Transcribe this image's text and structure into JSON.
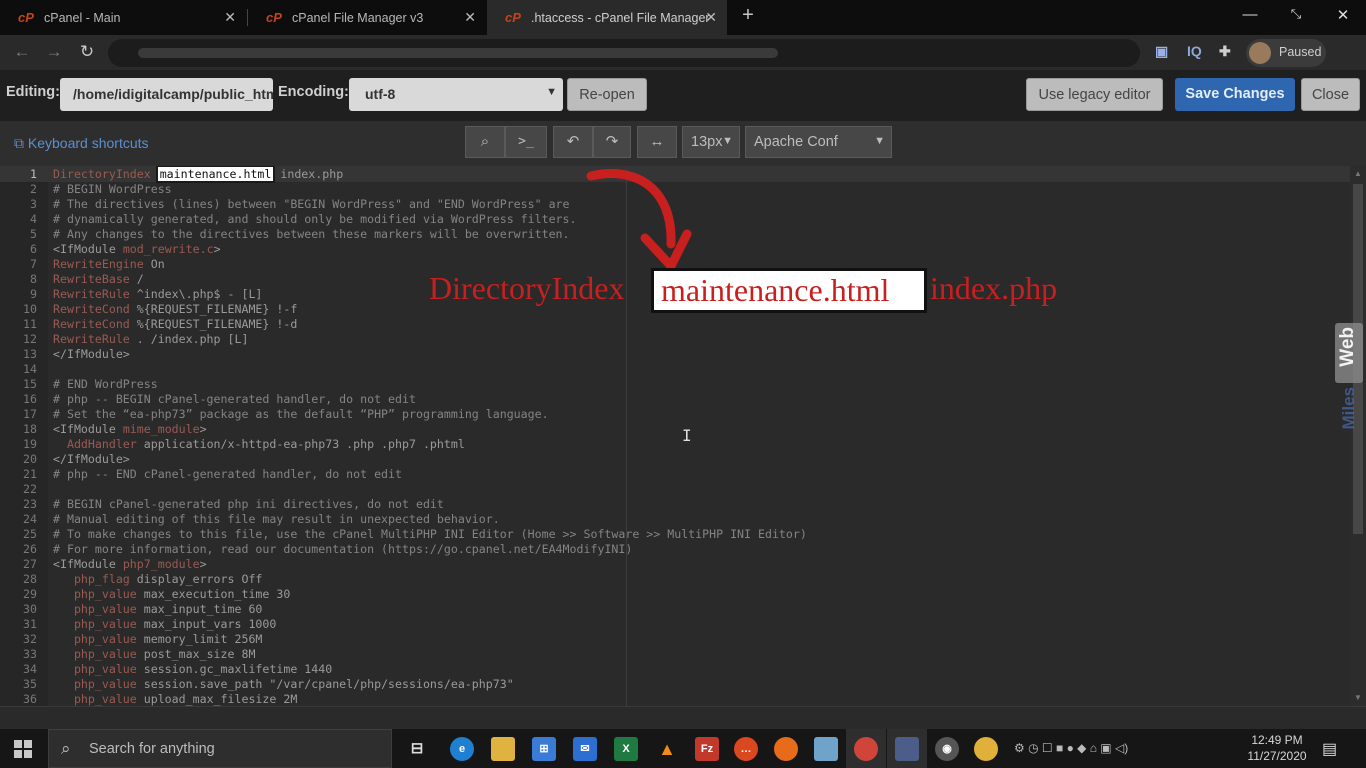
{
  "browser": {
    "tabs": [
      {
        "title": "cPanel - Main"
      },
      {
        "title": "cPanel File Manager v3"
      },
      {
        "title": ".htaccess - cPanel File Manager v"
      }
    ],
    "profile_status": "Paused",
    "extension_label": "IQ"
  },
  "editor_bar": {
    "editing_label": "Editing:",
    "path_value": "/home/idigitalcamp/public_html/.htaccess",
    "encoding_label": "Encoding:",
    "encoding_value": "utf-8",
    "reopen_label": "Re-open",
    "legacy_label": "Use legacy editor",
    "save_label": "Save Changes",
    "close_label": "Close"
  },
  "toolbar": {
    "shortcuts_label": "Keyboard shortcuts",
    "font_size": "13px",
    "mode": "Apache Conf"
  },
  "code_lines": [
    {
      "n": "1",
      "segs": [
        [
          "k",
          "DirectoryIndex "
        ],
        [
          "hl",
          "maintenance.html"
        ],
        [
          "t",
          " index.php"
        ]
      ]
    },
    {
      "n": "2",
      "segs": [
        [
          "c",
          "# BEGIN WordPress"
        ]
      ]
    },
    {
      "n": "3",
      "segs": [
        [
          "c",
          "# The directives (lines) between \"BEGIN WordPress\" and \"END WordPress\" are"
        ]
      ]
    },
    {
      "n": "4",
      "segs": [
        [
          "c",
          "# dynamically generated, and should only be modified via WordPress filters."
        ]
      ]
    },
    {
      "n": "5",
      "segs": [
        [
          "c",
          "# Any changes to the directives between these markers will be overwritten."
        ]
      ]
    },
    {
      "n": "6",
      "segs": [
        [
          "t",
          "<IfModule "
        ],
        [
          "k",
          "mod_rewrite.c"
        ],
        [
          "t",
          ">"
        ]
      ]
    },
    {
      "n": "7",
      "segs": [
        [
          "k",
          "RewriteEngine"
        ],
        [
          "t",
          " On"
        ]
      ]
    },
    {
      "n": "8",
      "segs": [
        [
          "k",
          "RewriteBase"
        ],
        [
          "t",
          " /"
        ]
      ]
    },
    {
      "n": "9",
      "segs": [
        [
          "k",
          "RewriteRule"
        ],
        [
          "t",
          " ^index\\.php$ - [L]"
        ]
      ]
    },
    {
      "n": "10",
      "segs": [
        [
          "k",
          "RewriteCond"
        ],
        [
          "t",
          " %{REQUEST_FILENAME} !-f"
        ]
      ]
    },
    {
      "n": "11",
      "segs": [
        [
          "k",
          "RewriteCond"
        ],
        [
          "t",
          " %{REQUEST_FILENAME} !-d"
        ]
      ]
    },
    {
      "n": "12",
      "segs": [
        [
          "k",
          "RewriteRule"
        ],
        [
          "t",
          " . /index.php [L]"
        ]
      ]
    },
    {
      "n": "13",
      "segs": [
        [
          "t",
          "</IfModule>"
        ]
      ]
    },
    {
      "n": "14",
      "segs": []
    },
    {
      "n": "15",
      "segs": [
        [
          "c",
          "# END WordPress"
        ]
      ]
    },
    {
      "n": "16",
      "segs": [
        [
          "c",
          "# php -- BEGIN cPanel-generated handler, do not edit"
        ]
      ]
    },
    {
      "n": "17",
      "segs": [
        [
          "c",
          "# Set the “ea-php73” package as the default “PHP” programming language."
        ]
      ]
    },
    {
      "n": "18",
      "segs": [
        [
          "t",
          "<IfModule "
        ],
        [
          "k",
          "mime_module"
        ],
        [
          "t",
          ">"
        ]
      ]
    },
    {
      "n": "19",
      "segs": [
        [
          "k",
          "  AddHandler"
        ],
        [
          "t",
          " application/x-httpd-ea-php73 .php .php7 .phtml"
        ]
      ]
    },
    {
      "n": "20",
      "segs": [
        [
          "t",
          "</IfModule>"
        ]
      ]
    },
    {
      "n": "21",
      "segs": [
        [
          "c",
          "# php -- END cPanel-generated handler, do not edit"
        ]
      ]
    },
    {
      "n": "22",
      "segs": []
    },
    {
      "n": "23",
      "segs": [
        [
          "c",
          "# BEGIN cPanel-generated php ini directives, do not edit"
        ]
      ]
    },
    {
      "n": "24",
      "segs": [
        [
          "c",
          "# Manual editing of this file may result in unexpected behavior."
        ]
      ]
    },
    {
      "n": "25",
      "segs": [
        [
          "c",
          "# To make changes to this file, use the cPanel MultiPHP INI Editor (Home >> Software >> MultiPHP INI Editor)"
        ]
      ]
    },
    {
      "n": "26",
      "segs": [
        [
          "c",
          "# For more information, read our documentation (https://go.cpanel.net/EA4ModifyINI)"
        ]
      ]
    },
    {
      "n": "27",
      "segs": [
        [
          "t",
          "<IfModule "
        ],
        [
          "k",
          "php7_module"
        ],
        [
          "t",
          ">"
        ]
      ]
    },
    {
      "n": "28",
      "segs": [
        [
          "k",
          "   php_flag"
        ],
        [
          "t",
          " display_errors Off"
        ]
      ]
    },
    {
      "n": "29",
      "segs": [
        [
          "k",
          "   php_value"
        ],
        [
          "t",
          " max_execution_time 30"
        ]
      ]
    },
    {
      "n": "30",
      "segs": [
        [
          "k",
          "   php_value"
        ],
        [
          "t",
          " max_input_time 60"
        ]
      ]
    },
    {
      "n": "31",
      "segs": [
        [
          "k",
          "   php_value"
        ],
        [
          "t",
          " max_input_vars 1000"
        ]
      ]
    },
    {
      "n": "32",
      "segs": [
        [
          "k",
          "   php_value"
        ],
        [
          "t",
          " memory_limit 256M"
        ]
      ]
    },
    {
      "n": "33",
      "segs": [
        [
          "k",
          "   php_value"
        ],
        [
          "t",
          " post_max_size 8M"
        ]
      ]
    },
    {
      "n": "34",
      "segs": [
        [
          "k",
          "   php_value"
        ],
        [
          "t",
          " session.gc_maxlifetime 1440"
        ]
      ]
    },
    {
      "n": "35",
      "segs": [
        [
          "k",
          "   php_value"
        ],
        [
          "t",
          " session.save_path \"/var/cpanel/php/sessions/ea-php73\""
        ]
      ]
    },
    {
      "n": "36",
      "segs": [
        [
          "k",
          "   php_value"
        ],
        [
          "t",
          " upload_max_filesize 2M"
        ]
      ]
    }
  ],
  "annotation": {
    "prefix": "DirectoryIndex ",
    "highlight": "maintenance.html",
    "suffix": " index.php",
    "arrow_color": "#c81f1f"
  },
  "watermark": {
    "brand": "Web",
    "sub": "Miles"
  },
  "taskbar": {
    "search_placeholder": "Search for anything",
    "time": "12:49 PM",
    "date": "11/27/2020"
  },
  "colors": {
    "accent_blue": "#2f66b0",
    "cpanel_orange": "#c4441a",
    "annotation_red": "#c81f1f"
  }
}
